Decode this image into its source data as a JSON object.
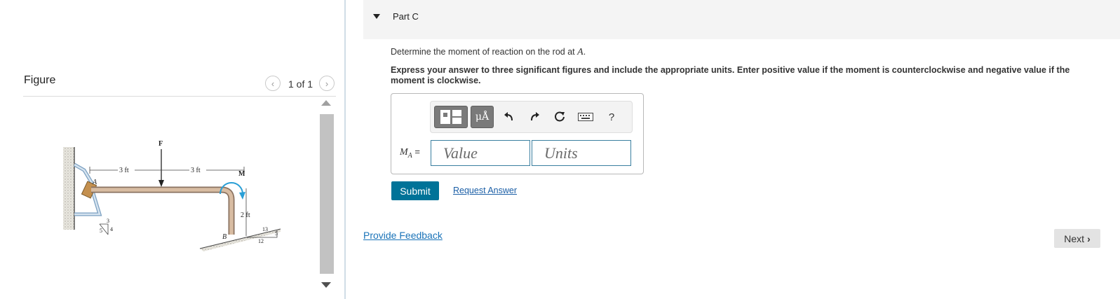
{
  "figure_panel": {
    "title": "Figure",
    "counter": "1 of 1",
    "prev_icon": "chevron-left-icon",
    "next_icon": "chevron-right-icon",
    "diagram_labels": {
      "force": "F",
      "dim_left": "3 ft",
      "dim_right": "3 ft",
      "moment": "M",
      "point_a": "A",
      "point_b": "B",
      "dim_vertical": "2 ft",
      "slope_a": [
        "3",
        "5",
        "4"
      ],
      "slope_b": [
        "13",
        "5",
        "12"
      ]
    }
  },
  "part": {
    "title": "Part C",
    "caret_icon": "caret-down-icon"
  },
  "question": {
    "text": "Determine the moment of reaction on the rod at ",
    "variable": "A",
    "end": ".",
    "instructions": "Express your answer to three significant figures and include the appropriate units. Enter positive value if the moment is counterclockwise and negative value if the moment is clockwise."
  },
  "toolbar": {
    "units_label": "μÅ",
    "help_label": "?",
    "icons": [
      "templates-icon",
      "units-icon",
      "undo-icon",
      "redo-icon",
      "reset-icon",
      "keyboard-icon",
      "help-icon"
    ]
  },
  "answer": {
    "label_var": "M",
    "label_sub": "A",
    "label_eq": " =",
    "value_placeholder": "Value",
    "units_placeholder": "Units"
  },
  "actions": {
    "submit_label": "Submit",
    "request_label": "Request Answer",
    "feedback_label": "Provide Feedback",
    "next_label": "Next",
    "next_icon": "›"
  },
  "colors": {
    "accent": "#007398",
    "link": "#1a5ea6",
    "input_border": "#3a7fa0",
    "rod": "#c9a98c",
    "moment_arrow": "#2a9fd6"
  }
}
